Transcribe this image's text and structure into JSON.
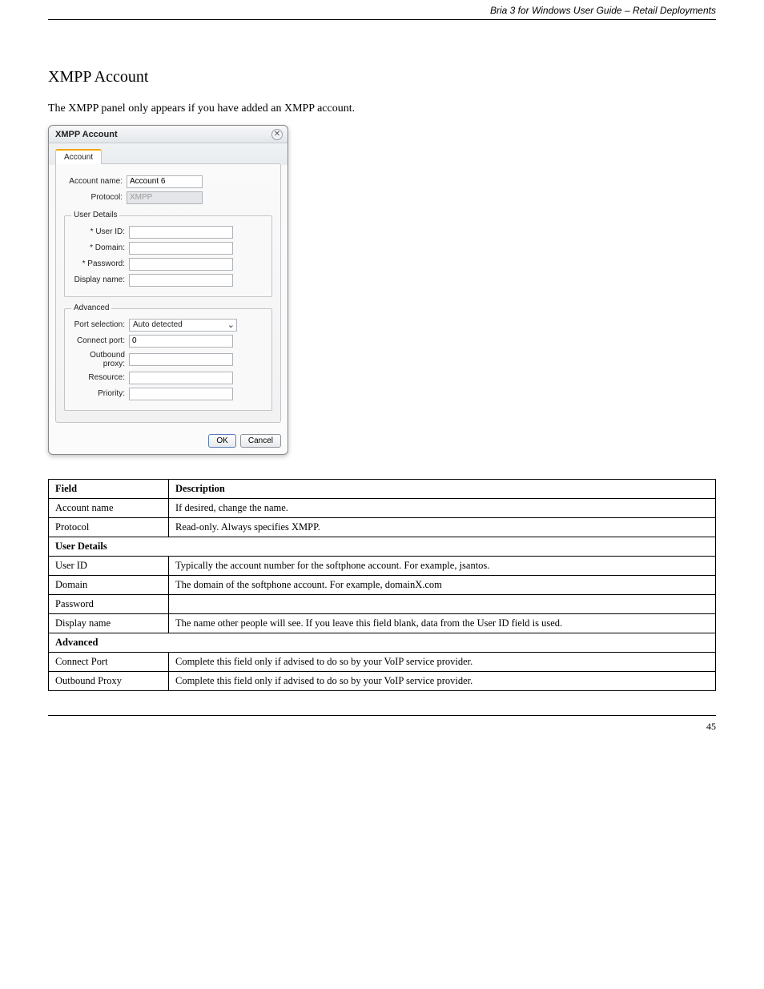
{
  "header": {
    "right": "Bria 3 for Windows User Guide – Retail Deployments"
  },
  "section": {
    "title": "XMPP Account",
    "intro": "The XMPP panel only appears if you have added an XMPP account."
  },
  "dialog": {
    "title": "XMPP Account",
    "tab": "Account",
    "fields": {
      "account_name_label": "Account name:",
      "account_name_value": "Account 6",
      "protocol_label": "Protocol:",
      "protocol_value": "XMPP"
    },
    "user_details": {
      "legend": "User Details",
      "user_id_label": "* User ID:",
      "domain_label": "* Domain:",
      "password_label": "* Password:",
      "display_name_label": "Display name:"
    },
    "advanced": {
      "legend": "Advanced",
      "port_selection_label": "Port selection:",
      "port_selection_value": "Auto detected",
      "connect_port_label": "Connect port:",
      "connect_port_value": "0",
      "outbound_proxy_label": "Outbound proxy:",
      "resource_label": "Resource:",
      "priority_label": "Priority:"
    },
    "buttons": {
      "ok": "OK",
      "cancel": "Cancel"
    }
  },
  "table": {
    "headers": {
      "field": "Field",
      "description": "Description"
    },
    "rows": [
      {
        "field": "Account name",
        "desc": "If desired, change the name."
      },
      {
        "field": "Protocol",
        "desc": "Read-only. Always specifies XMPP."
      }
    ],
    "section1": "User Details",
    "rows2": [
      {
        "field": "User ID",
        "desc": "Typically the account number for the softphone account. For example, jsantos."
      },
      {
        "field": "Domain",
        "desc": "The domain of the softphone account. For example, domainX.com"
      },
      {
        "field": "Password",
        "desc": ""
      },
      {
        "field": "Display name",
        "desc": "The name other people will see. If you leave this field blank, data from the User ID field is used."
      }
    ],
    "section2": "Advanced",
    "rows3": [
      {
        "field": "Connect Port",
        "desc": "Complete this field only if advised to do so by your VoIP service provider."
      },
      {
        "field": "Outbound Proxy",
        "desc": "Complete this field only if advised to do so by your VoIP service provider."
      }
    ]
  },
  "footer": {
    "page": "45"
  }
}
